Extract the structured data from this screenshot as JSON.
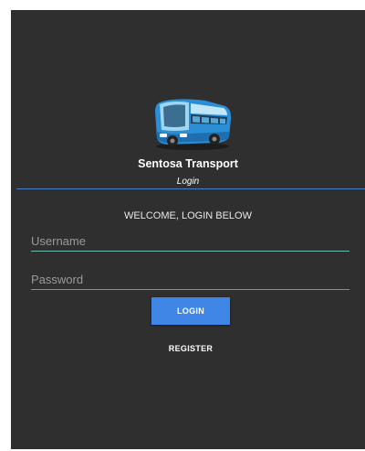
{
  "app": {
    "name": "Sentosa Transport",
    "subtitle": "Login",
    "logo_icon": "bus-icon"
  },
  "login": {
    "welcome": "WELCOME, LOGIN BELOW",
    "username_placeholder": "Username",
    "username_value": "",
    "password_placeholder": "Password",
    "password_value": "",
    "login_label": "LOGIN",
    "register_label": "REGISTER"
  },
  "colors": {
    "background": "#2f2f2f",
    "accent": "#3f86e6",
    "divider": "#4a7fc4",
    "username_underline": "#6fb7a9"
  }
}
